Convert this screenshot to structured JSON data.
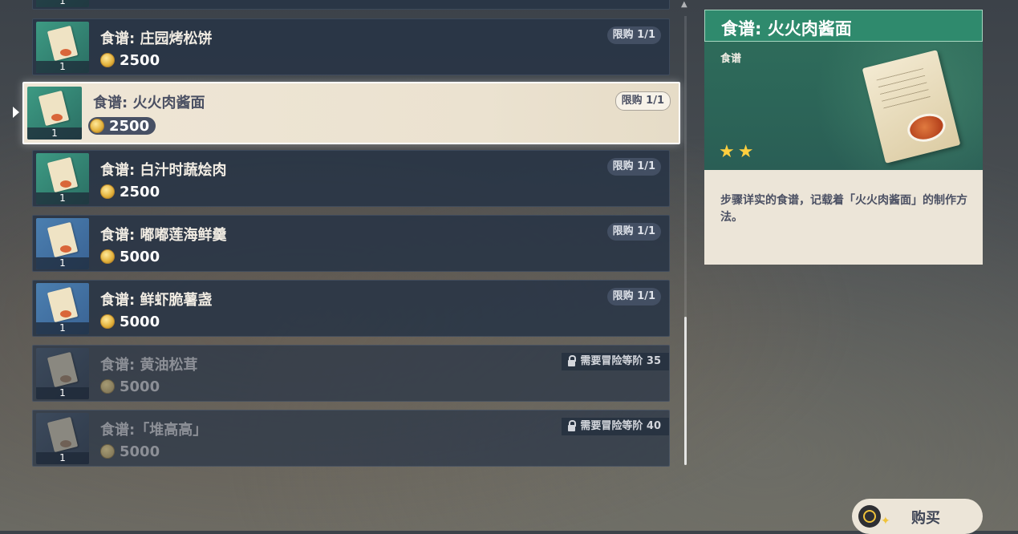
{
  "shop_list": {
    "items": [
      {
        "name": "",
        "price": "",
        "limit": "",
        "qty": "1",
        "locked": false,
        "partial": true
      },
      {
        "name": "食谱: 庄园烤松饼",
        "price": "2500",
        "limit": "限购 1/1",
        "qty": "1",
        "locked": false
      },
      {
        "name": "食谱: 火火肉酱面",
        "price": "2500",
        "limit": "限购 1/1",
        "qty": "1",
        "locked": false,
        "selected": true
      },
      {
        "name": "食谱: 白汁时蔬烩肉",
        "price": "2500",
        "limit": "限购 1/1",
        "qty": "1",
        "locked": false
      },
      {
        "name": "食谱: 嘟嘟莲海鲜羹",
        "price": "5000",
        "limit": "限购 1/1",
        "qty": "1",
        "locked": false
      },
      {
        "name": "食谱: 鲜虾脆薯盏",
        "price": "5000",
        "limit": "限购 1/1",
        "qty": "1",
        "locked": false
      },
      {
        "name": "食谱: 黄油松茸",
        "price": "5000",
        "requirement": "需要冒险等阶 35",
        "qty": "1",
        "locked": true
      },
      {
        "name": "食谱:「堆高高」",
        "price": "5000",
        "requirement": "需要冒险等阶 40",
        "qty": "1",
        "locked": true
      }
    ]
  },
  "detail": {
    "title": "食谱: 火火肉酱面",
    "type": "食谱",
    "rarity_stars": 2,
    "description": "步骤详实的食谱，记载着「火火肉酱面」的制作方法。"
  },
  "buy_button": {
    "label": "购买",
    "icon": "controller-circle-button-icon"
  },
  "colors": {
    "accent_green": "#2f8a6d",
    "coin_gold": "#e3b23c",
    "star_yellow": "#ffcf3f"
  }
}
